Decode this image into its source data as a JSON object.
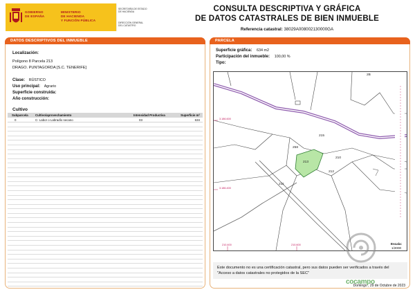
{
  "header": {
    "gov_line1": "GOBIERNO",
    "gov_line2": "DE ESPAÑA",
    "min_line1": "MINISTERIO",
    "min_line2": "DE HACIENDA",
    "min_line3": "Y FUNCIÓN PÚBLICA",
    "sec_line1": "SECRETARÍA DE ESTADO",
    "sec_line2": "DE HACIENDA",
    "dir_line1": "DIRECCIÓN GENERAL",
    "dir_line2": "DEL CATASTRO",
    "title_line1": "CONSULTA DESCRIPTIVA Y GRÁFICA",
    "title_line2": "DE DATOS CATASTRALES DE BIEN INMUEBLE",
    "ref_label": "Referencia catastral:",
    "ref_value": "38029A008002130000GA",
    "colors": {
      "band": "#f6c21c",
      "gov_text": "#b0161b",
      "accent": "#e8621d"
    }
  },
  "left": {
    "panel_title": "DATOS DESCRIPTIVOS DEL INMUEBLE",
    "localizacion_label": "Localización:",
    "loc_line1": "Polígono 8 Parcela 213",
    "loc_line2": "DRAGO. PUNTAGORDA [S.C. TENERIFE]",
    "clase_label": "Clase:",
    "clase_value": "RÚSTICO",
    "uso_label": "Uso principal:",
    "uso_value": "Agrario",
    "sup_construida_label": "Superficie construida:",
    "anio_label": "Año construcción:",
    "cultivo_title": "Cultivo",
    "table_headers": [
      "Subparcela",
      "Cultivo/aprovechamiento",
      "Intensidad Productiva",
      "Superficie m²"
    ],
    "table_rows": [
      {
        "subparcela": "0",
        "cultivo": "C- Labor o Labradío secano",
        "intensidad": "03",
        "superficie": "634"
      }
    ]
  },
  "right": {
    "panel_title": "PARCELA",
    "sup_grafica_label": "Superficie gráfica:",
    "sup_grafica_value": "634 m2",
    "participacion_label": "Participación del inmueble:",
    "participacion_value": "100,00 %",
    "tipo_label": "Tipo:",
    "map": {
      "parcel_labels": [
        "2B",
        "215",
        "258",
        "213",
        "210",
        "212",
        "211"
      ],
      "highlight_color": "#b8e6a6",
      "coord_labels": [
        "3.186.600",
        "3.186.400",
        "210.400",
        "210.600"
      ],
      "scale_label": "Escala:",
      "scale_value": "1/2000"
    },
    "notice": "Este documento no es una certificación catastral, pero sus datos pueden ser verificados a través del \"Acceso a datos catastrales no protegidos de la SEC\"",
    "date": "Domingo , 29 de Octubre de 2023"
  },
  "watermark": {
    "text": "cocampo",
    "color": "#4a9e46"
  }
}
